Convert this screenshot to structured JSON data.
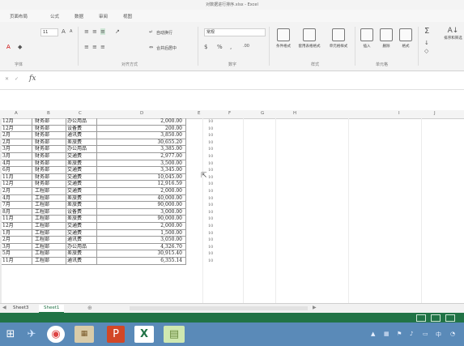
{
  "window": {
    "title": "对数据进行排序.xlsx - Excel"
  },
  "menu": {
    "tabs": [
      "页面布局",
      "公式",
      "数据",
      "审阅",
      "视图"
    ]
  },
  "ribbon": {
    "font_size": "11",
    "wrap_text": "自动换行",
    "number_format": "常规",
    "merge_center": "合并后居中",
    "groups": {
      "font": "字体",
      "alignment": "对齐方式",
      "number": "数字",
      "styles": "样式",
      "cells": "单元格"
    },
    "buttons": {
      "conditional_format": "条件格式",
      "table_format": "套用表格格式",
      "cell_styles": "单元格样式",
      "insert": "插入",
      "delete": "删除",
      "format": "格式",
      "sort_filter": "排序和筛选"
    }
  },
  "formula_bar": {
    "fx": "fx",
    "content": ""
  },
  "columns": [
    "A",
    "B",
    "C",
    "D",
    "E",
    "F",
    "G",
    "H",
    "I",
    "J"
  ],
  "sheet": {
    "rows": [
      {
        "month": "12月",
        "dept": "财务部",
        "item": "办公用品",
        "amount": "2,000.00",
        "f": "10"
      },
      {
        "month": "12月",
        "dept": "财务部",
        "item": "设备费",
        "amount": "200.00",
        "f": "10"
      },
      {
        "month": "2月",
        "dept": "财务部",
        "item": "通讯费",
        "amount": "3,850.00",
        "f": "10"
      },
      {
        "month": "2月",
        "dept": "财务部",
        "item": "差旅费",
        "amount": "30,655.20",
        "f": "10"
      },
      {
        "month": "3月",
        "dept": "财务部",
        "item": "办公用品",
        "amount": "3,385.00",
        "f": "10"
      },
      {
        "month": "3月",
        "dept": "财务部",
        "item": "交通费",
        "amount": "2,977.00",
        "f": "10"
      },
      {
        "month": "4月",
        "dept": "财务部",
        "item": "差旅费",
        "amount": "3,500.00",
        "f": "10"
      },
      {
        "month": "6月",
        "dept": "财务部",
        "item": "交通费",
        "amount": "3,345.00",
        "f": "10"
      },
      {
        "month": "11月",
        "dept": "财务部",
        "item": "交通费",
        "amount": "10,045.00",
        "f": "10"
      },
      {
        "month": "12月",
        "dept": "财务部",
        "item": "交通费",
        "amount": "12,916.59",
        "f": "10"
      },
      {
        "month": "2月",
        "dept": "工程部",
        "item": "交通费",
        "amount": "2,000.00",
        "f": "10"
      },
      {
        "month": "4月",
        "dept": "工程部",
        "item": "差旅费",
        "amount": "40,000.00",
        "f": "10"
      },
      {
        "month": "7月",
        "dept": "工程部",
        "item": "差旅费",
        "amount": "90,000.00",
        "f": "10"
      },
      {
        "month": "8月",
        "dept": "工程部",
        "item": "设备费",
        "amount": "3,000.00",
        "f": "10"
      },
      {
        "month": "11月",
        "dept": "工程部",
        "item": "差旅费",
        "amount": "90,000.00",
        "f": "10"
      },
      {
        "month": "12月",
        "dept": "工程部",
        "item": "交通费",
        "amount": "2,000.00",
        "f": "10"
      },
      {
        "month": "1月",
        "dept": "工程部",
        "item": "交通费",
        "amount": "1,500.00",
        "f": "10"
      },
      {
        "month": "2月",
        "dept": "工程部",
        "item": "通讯费",
        "amount": "3,050.00",
        "f": "10"
      },
      {
        "month": "3月",
        "dept": "工程部",
        "item": "办公用品",
        "amount": "4,326.70",
        "f": "10"
      },
      {
        "month": "5月",
        "dept": "工程部",
        "item": "差旅费",
        "amount": "30,915.40",
        "f": "10"
      },
      {
        "month": "11月",
        "dept": "工程部",
        "item": "通讯费",
        "amount": "6,355.14",
        "f": "10"
      }
    ]
  },
  "sheet_tabs": [
    {
      "name": "Sheet3",
      "active": false
    },
    {
      "name": "Sheet1",
      "active": true
    }
  ],
  "taskbar": {
    "apps": [
      "windows-start",
      "browser",
      "chrome",
      "photo-viewer",
      "powerpoint",
      "excel",
      "notes"
    ],
    "colors": {
      "bar": "#5a8ab8",
      "status": "#217346"
    }
  }
}
